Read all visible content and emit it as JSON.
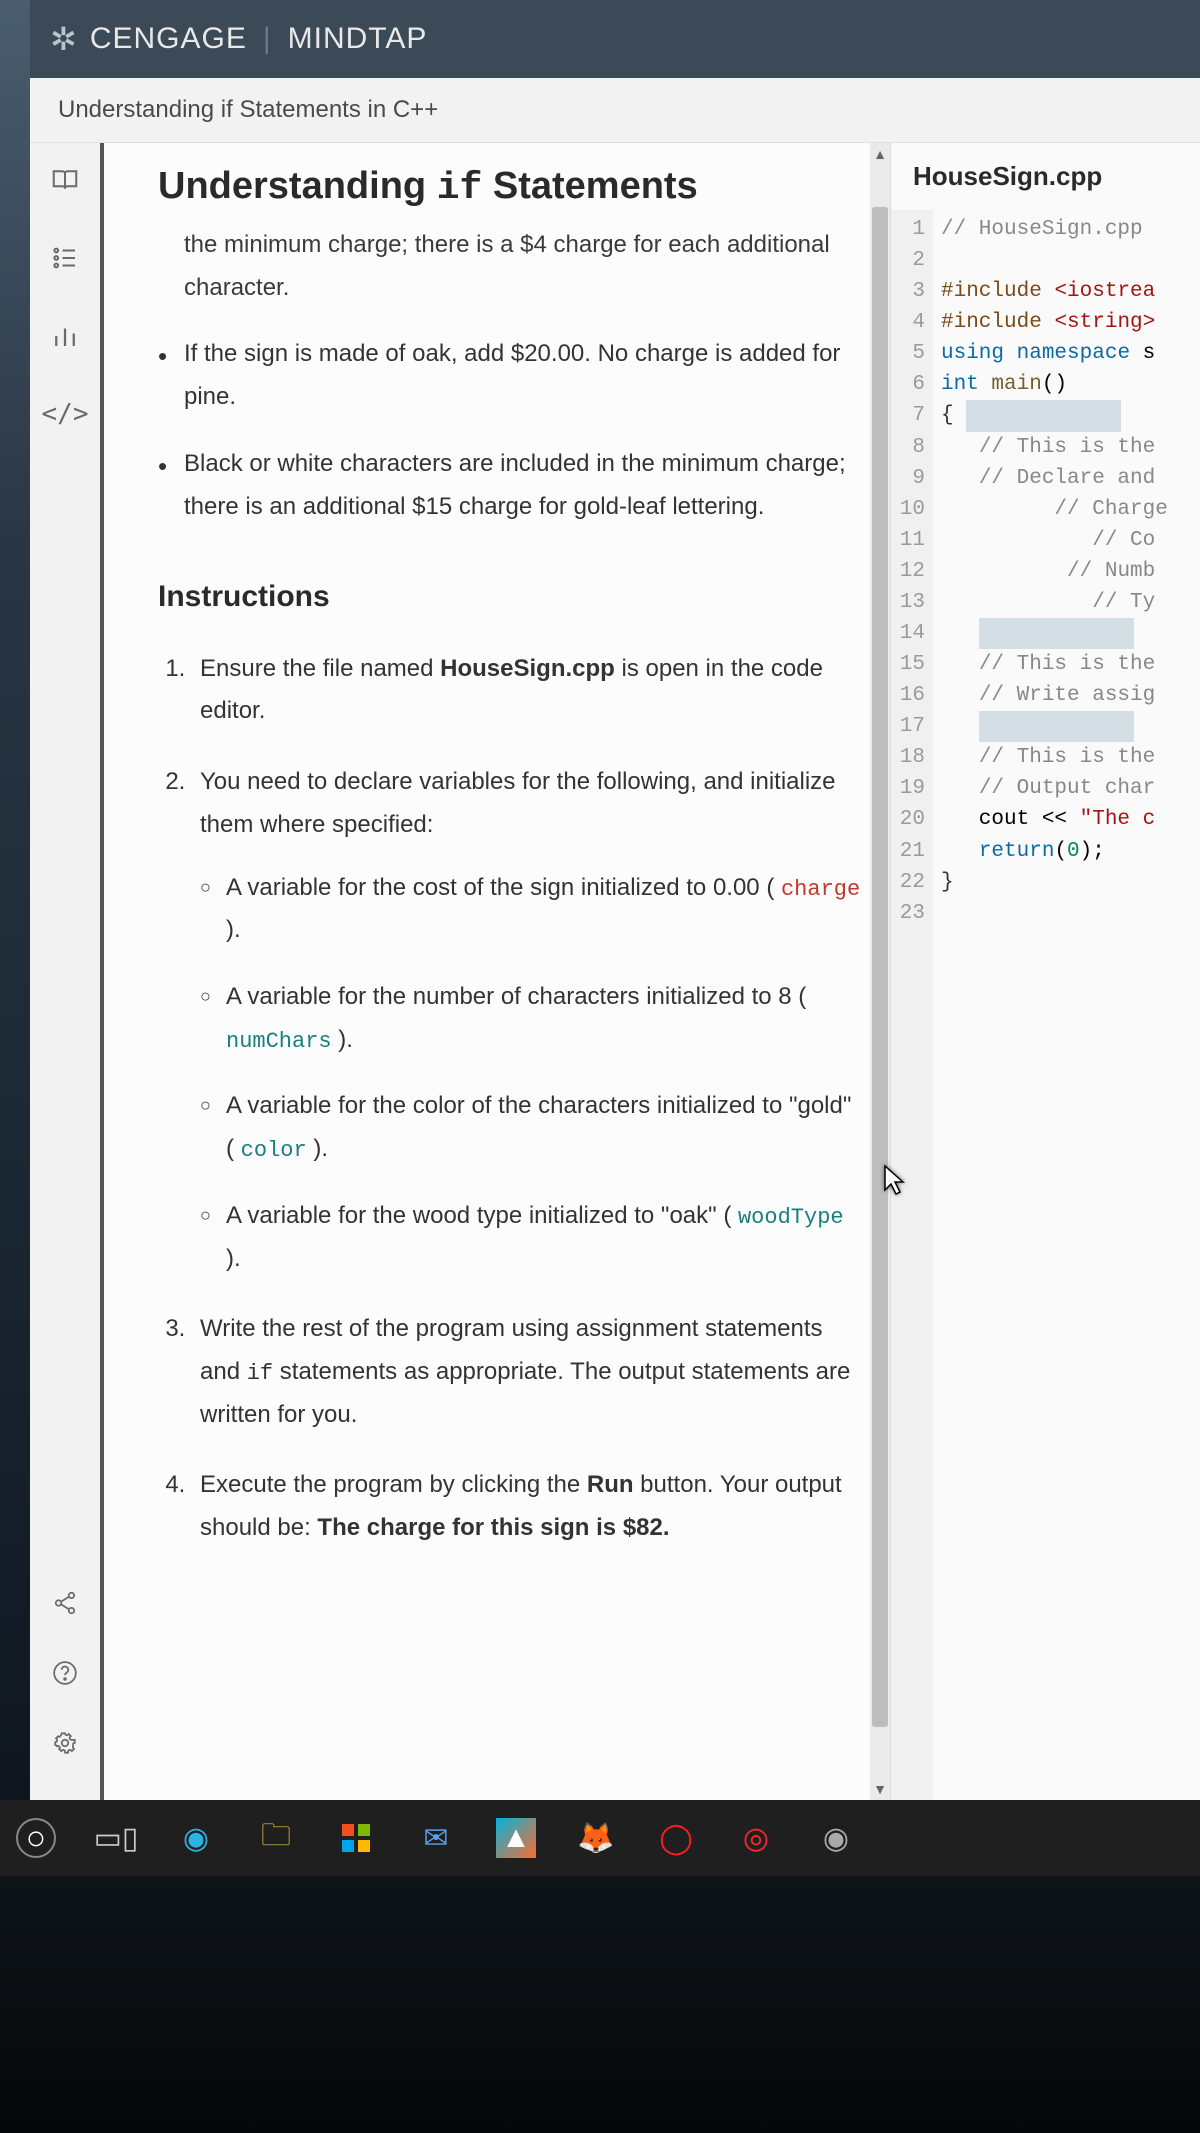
{
  "brand": {
    "name": "CENGAGE",
    "product": "MINDTAP"
  },
  "subtitle": "Understanding if Statements in C++",
  "rail": {
    "book": "book-icon",
    "checklist": "checklist-icon",
    "chart": "bar-chart-icon",
    "code": "code-icon",
    "share": "share-icon",
    "help": "help-icon",
    "settings": "gear-icon"
  },
  "lesson": {
    "heading_pre": "Understanding ",
    "heading_kw": "if",
    "heading_post": " Statements",
    "truncated_line": "the minimum charge; there is a $4 charge for each additional character.",
    "bullets": [
      "If the sign is made of oak, add $20.00. No charge is added for pine.",
      "Black or white characters are included in the minimum charge; there is an additional $15 charge for gold-leaf lettering."
    ],
    "instructions_heading": "Instructions",
    "steps": {
      "s1_pre": "Ensure the file named ",
      "s1_bold": "HouseSign.cpp",
      "s1_post": " is open in the code editor.",
      "s2": "You need to declare variables for the following, and initialize them where specified:",
      "s2_items": [
        {
          "text_a": "A variable for the cost of the sign initialized to 0.00 ( ",
          "code": "charge",
          "code_class": "c-red",
          "text_b": " )."
        },
        {
          "text_a": "A variable for the number of characters initialized to 8 ( ",
          "code": "numChars",
          "code_class": "c-cyan",
          "text_b": " )."
        },
        {
          "text_a": "A variable for the color of the characters initialized to \"gold\" ( ",
          "code": "color",
          "code_class": "c-cyan",
          "text_b": " )."
        },
        {
          "text_a": "A variable for the wood type initialized to \"oak\" ( ",
          "code": "woodType",
          "code_class": "c-cyan",
          "text_b": " )."
        }
      ],
      "s3_pre": "Write the rest of the program using assignment statements and ",
      "s3_kw": "if",
      "s3_post": " statements as appropriate. The output statements are written for you.",
      "s4_pre": "Execute the program by clicking the ",
      "s4_bold1": "Run",
      "s4_mid": " button. Your output should be: ",
      "s4_bold2": "The charge for this sign is $82."
    }
  },
  "editor": {
    "filename": "HouseSign.cpp",
    "lines": [
      {
        "n": 1,
        "html": "<span class='tok-comment'>// HouseSign.cpp</span>"
      },
      {
        "n": 2,
        "html": ""
      },
      {
        "n": 3,
        "html": "<span class='tok-pre'>#include</span> <span class='tok-str'>&lt;iostrea</span>"
      },
      {
        "n": 4,
        "html": "<span class='tok-pre'>#include</span> <span class='tok-str'>&lt;string&gt;</span>"
      },
      {
        "n": 5,
        "html": "<span class='tok-kw'>using</span> <span class='tok-kw'>namespace</span> s"
      },
      {
        "n": 6,
        "html": "<span class='tok-kw'>int</span> <span class='tok-fn'>main</span>()"
      },
      {
        "n": 7,
        "html": "<span class='tok-br'>{</span> <span class='sel-bg'>            </span>"
      },
      {
        "n": 8,
        "html": "   <span class='tok-comment'>// This is the</span>"
      },
      {
        "n": 9,
        "html": "   <span class='tok-comment'>// Declare and</span>"
      },
      {
        "n": 10,
        "html": "         <span class='tok-comment'>// Charge</span>"
      },
      {
        "n": 11,
        "html": "            <span class='tok-comment'>// Co</span>"
      },
      {
        "n": 12,
        "html": "          <span class='tok-comment'>// Numb</span>"
      },
      {
        "n": 13,
        "html": "            <span class='tok-comment'>// Ty</span>"
      },
      {
        "n": 14,
        "html": "   <span class='sel-bg'>            </span>"
      },
      {
        "n": 15,
        "html": "   <span class='tok-comment'>// This is the</span>"
      },
      {
        "n": 16,
        "html": "   <span class='tok-comment'>// Write assig</span>"
      },
      {
        "n": 17,
        "html": "   <span class='sel-bg'>            </span>"
      },
      {
        "n": 18,
        "html": "   <span class='tok-comment'>// This is the</span>"
      },
      {
        "n": 19,
        "html": "   <span class='tok-comment'>// Output char</span>"
      },
      {
        "n": 20,
        "html": "   cout &lt;&lt; <span class='tok-str'>\"The c</span>"
      },
      {
        "n": 21,
        "html": "   <span class='tok-kw'>return</span>(<span class='tok-num'>0</span>);"
      },
      {
        "n": 22,
        "html": "<span class='tok-br'>}</span>"
      },
      {
        "n": 23,
        "html": ""
      }
    ]
  },
  "taskbar": {
    "items": [
      "start",
      "task-view",
      "edge",
      "file-explorer",
      "ms-store",
      "mail",
      "photos",
      "firefox",
      "opera",
      "opera-gx",
      "cortana"
    ]
  }
}
